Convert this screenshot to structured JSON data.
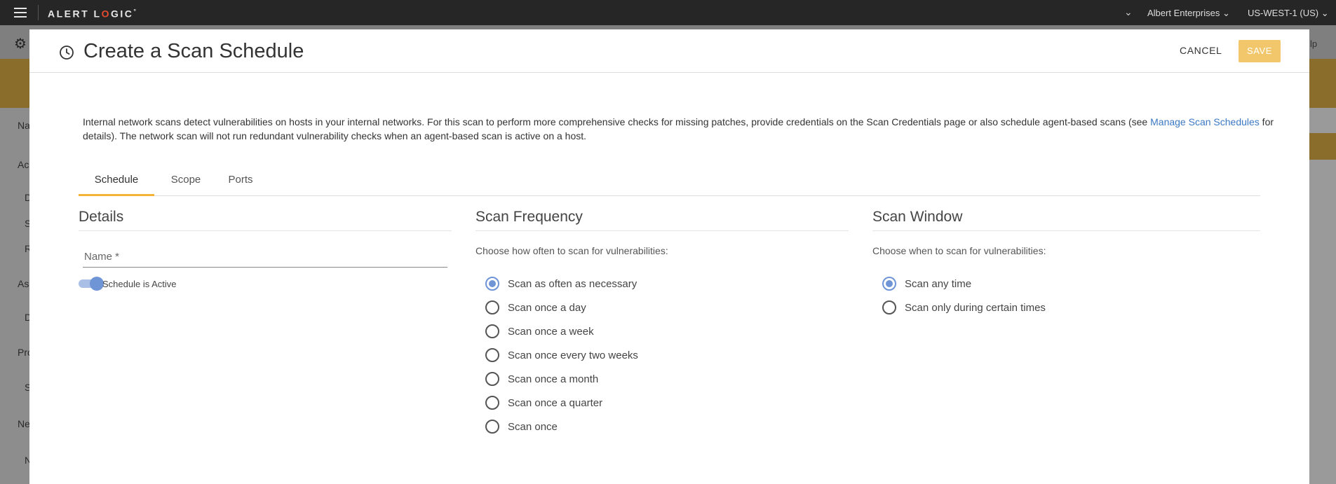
{
  "topbar": {
    "logo_a": "ALERT L",
    "logo_o": "O",
    "logo_b": "GIC",
    "logo_mark": "°",
    "account": "Albert Enterprises",
    "region": "US-WEST-1 (US)"
  },
  "background": {
    "help_partial": "lp",
    "labels": [
      "Na",
      "Ac",
      "D",
      "S",
      "R",
      "As",
      "D",
      "Pro",
      "S",
      "Ne",
      "N"
    ]
  },
  "modal": {
    "title": "Create a Scan Schedule",
    "cancel_label": "CANCEL",
    "save_label": "SAVE",
    "intro_text_1": "Internal network scans detect vulnerabilities on hosts in your internal networks. For this scan to perform more comprehensive checks for missing patches, provide credentials on the Scan Credentials page or also schedule agent-based scans (see ",
    "intro_link": "Manage Scan Schedules",
    "intro_text_2": " for details). The network scan will not run redundant vulnerability checks when an agent-based scan is active on a host.",
    "tabs": [
      {
        "label": "Schedule",
        "active": true
      },
      {
        "label": "Scope",
        "active": false
      },
      {
        "label": "Ports",
        "active": false
      }
    ],
    "details": {
      "heading": "Details",
      "name_placeholder": "Name *",
      "toggle_label": "Schedule is Active",
      "toggle_on": true
    },
    "frequency": {
      "heading": "Scan Frequency",
      "help": "Choose how often to scan for vulnerabilities:",
      "options": [
        {
          "label": "Scan as often as necessary",
          "selected": true
        },
        {
          "label": "Scan once a day",
          "selected": false
        },
        {
          "label": "Scan once a week",
          "selected": false
        },
        {
          "label": "Scan once every two weeks",
          "selected": false
        },
        {
          "label": "Scan once a month",
          "selected": false
        },
        {
          "label": "Scan once a quarter",
          "selected": false
        },
        {
          "label": "Scan once",
          "selected": false
        }
      ]
    },
    "window": {
      "heading": "Scan Window",
      "help": "Choose when to scan for vulnerabilities:",
      "options": [
        {
          "label": "Scan any time",
          "selected": true
        },
        {
          "label": "Scan only during certain times",
          "selected": false
        }
      ]
    }
  },
  "colors": {
    "accent_blue": "#6f95d6",
    "save_yellow": "#f2c76b",
    "tab_underline": "#f5b335",
    "link_blue": "#3c78c3"
  }
}
